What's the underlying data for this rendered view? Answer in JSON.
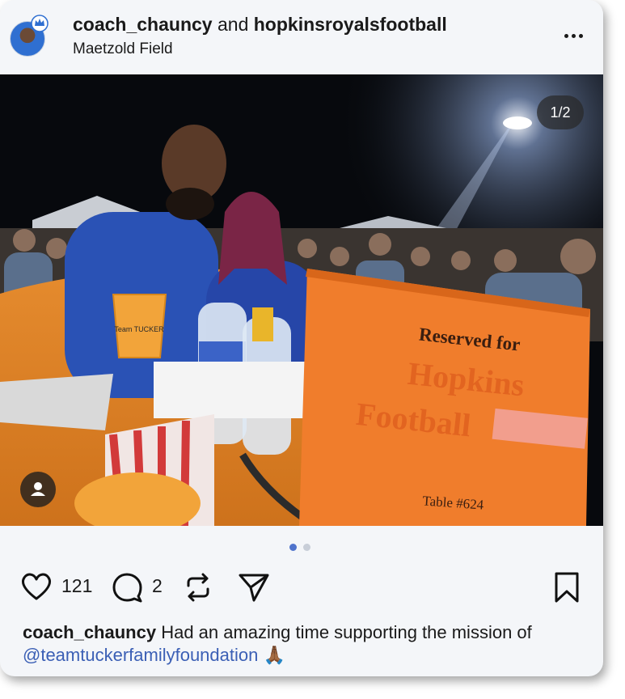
{
  "post": {
    "author_primary": "coach_chauncy",
    "author_joiner": " and ",
    "author_secondary": "hopkinsroyalsfootball",
    "location": "Maetzold Field",
    "image_counter": "1/2",
    "image_sign": {
      "line1": "Reserved for",
      "line2": "Hopkins",
      "line3": "Football",
      "table": "Table #624"
    },
    "cup_text": "Team TUCKER"
  },
  "actions": {
    "likes": "121",
    "comments": "2"
  },
  "caption": {
    "user": "coach_chauncy",
    "text": " Had an amazing time supporting the mission of ",
    "mention": "@teamtuckerfamilyfoundation",
    "emoji": " 🙏🏾"
  },
  "carousel": {
    "total": 2,
    "active": 1
  },
  "icons": [
    "more-options-icon",
    "user-tag-icon",
    "heart-icon",
    "comment-icon",
    "repost-icon",
    "share-icon",
    "bookmark-icon"
  ],
  "colors": {
    "mention": "#3b5fb5",
    "carousel_active": "#4f73cc",
    "card_bg": "#f4f6f9"
  }
}
